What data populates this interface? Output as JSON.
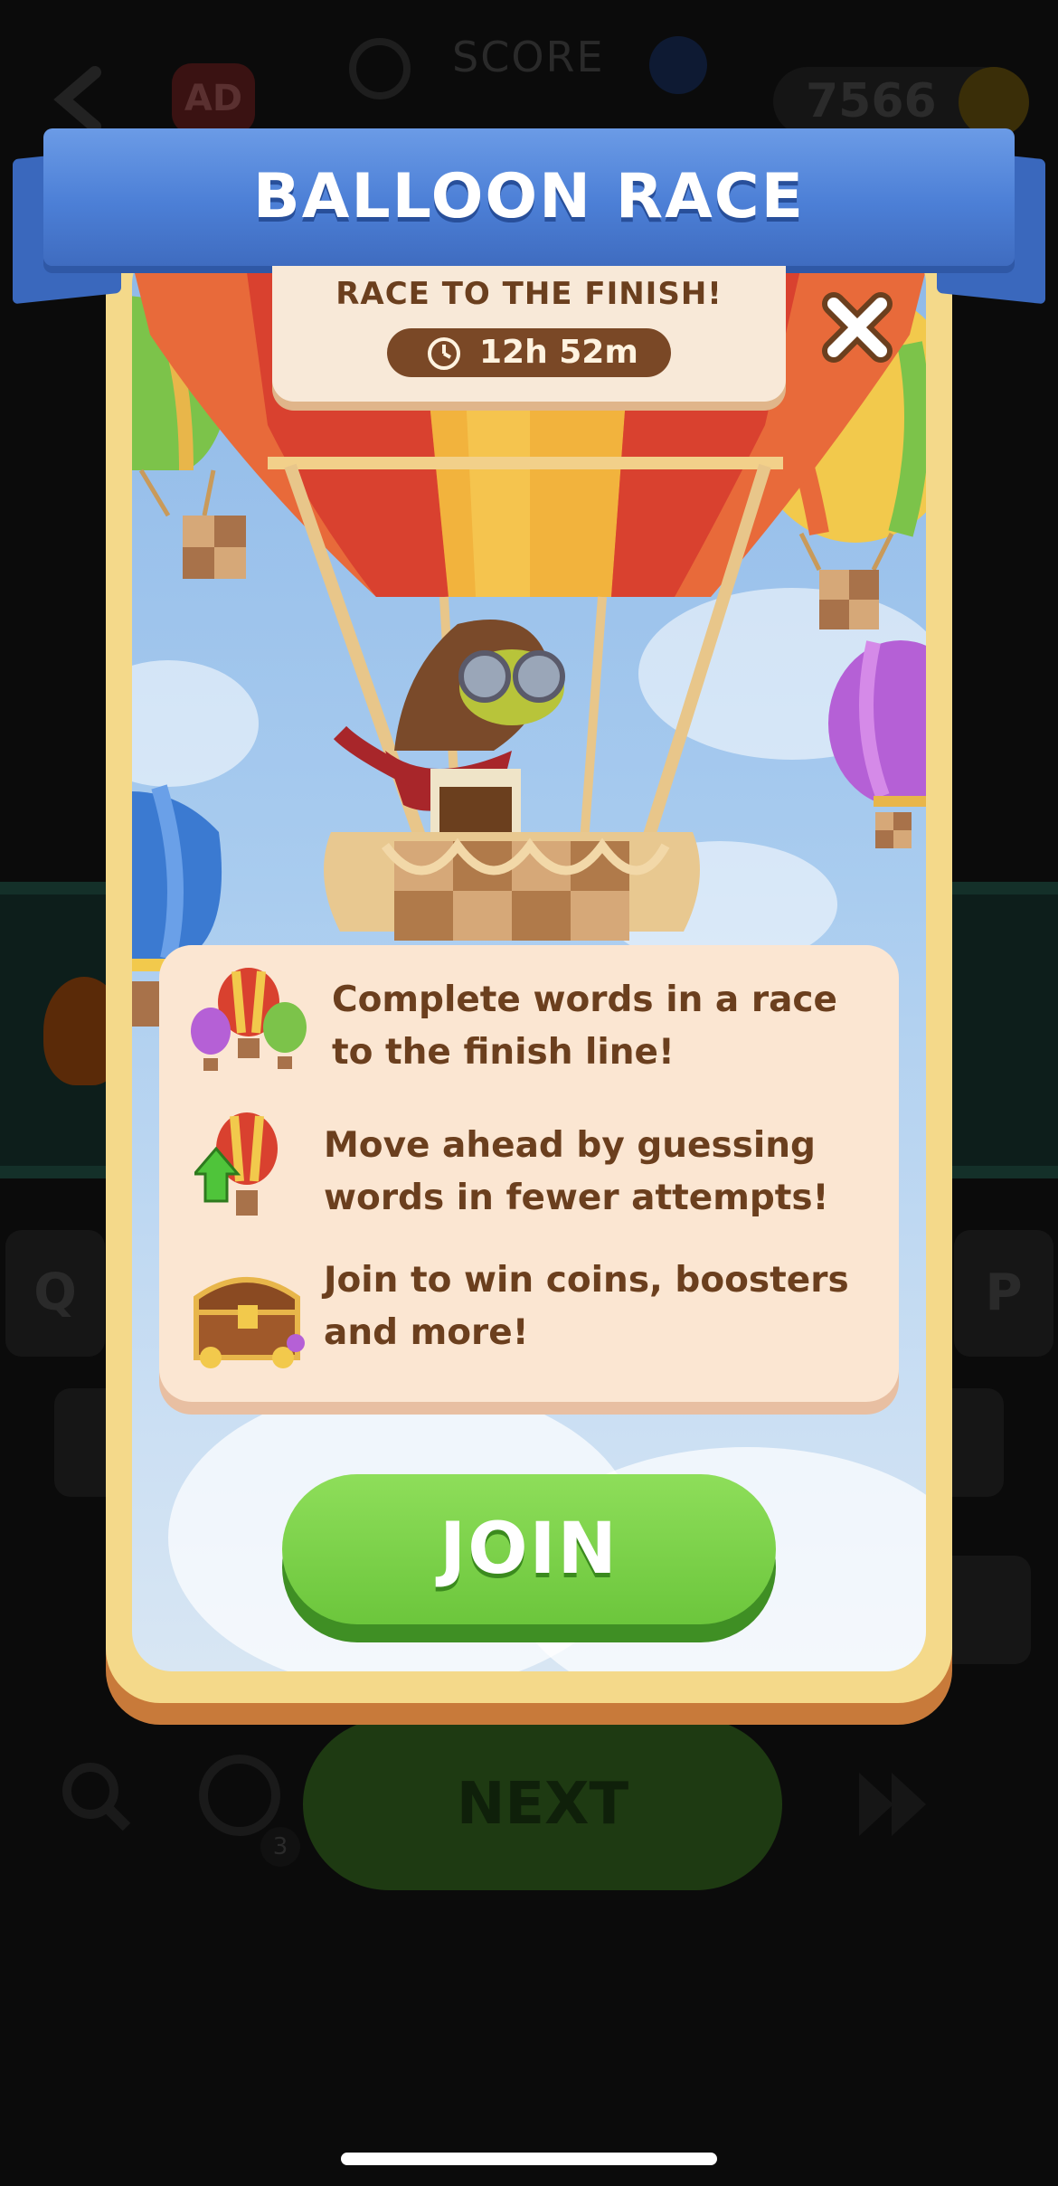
{
  "background": {
    "ad_label": "AD",
    "score_label": "SCORE",
    "coins": "7566",
    "keys": [
      "Q",
      "P"
    ],
    "next_label": "NEXT",
    "hint_count": "3"
  },
  "modal": {
    "title": "BALLOON RACE",
    "subtitle": "RACE TO THE FINISH!",
    "timer": "12h 52m",
    "info": [
      {
        "icon": "balloons-icon",
        "text_line1": "Complete words in a race",
        "text_line2": "to the finish line!"
      },
      {
        "icon": "balloon-up-arrow-icon",
        "text_line1": "Move ahead by guessing",
        "text_line2": "words in fewer attempts!"
      },
      {
        "icon": "treasure-chest-icon",
        "text_line1": "Join to win coins, boosters",
        "text_line2": "and more!"
      }
    ],
    "join_label": "JOIN"
  },
  "colors": {
    "ribbon": "#4c7fd6",
    "frame": "#f4d98a",
    "text_brown": "#6b3f1e",
    "join_green": "#6cc63c"
  }
}
